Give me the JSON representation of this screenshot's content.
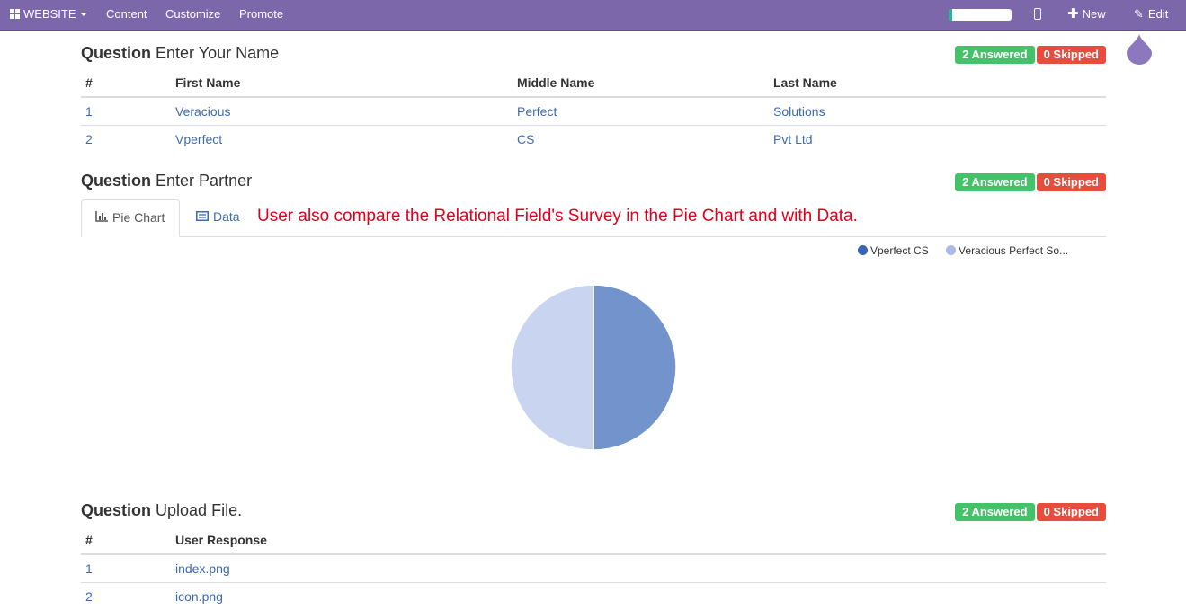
{
  "topbar": {
    "website_label": "WEBSITE",
    "menu": [
      "Content",
      "Customize",
      "Promote"
    ],
    "progress": 0.06,
    "new_label": "New",
    "edit_label": "Edit",
    "color": "#7c67ab"
  },
  "q1": {
    "prefix": "Question",
    "title": "Enter Your Name",
    "answered": "2 Answered",
    "skipped": "0 Skipped",
    "columns": [
      "#",
      "First Name",
      "Middle Name",
      "Last Name"
    ],
    "rows": [
      [
        "1",
        "Veracious",
        "Perfect",
        "Solutions"
      ],
      [
        "2",
        "Vperfect",
        "CS",
        "Pvt Ltd"
      ]
    ]
  },
  "q2": {
    "prefix": "Question",
    "title": "Enter Partner",
    "answered": "2 Answered",
    "skipped": "0 Skipped",
    "tabs": {
      "pie": "Pie Chart",
      "data": "Data"
    },
    "note": "User also compare the Relational Field's Survey in the Pie Chart and with Data."
  },
  "chart_data": {
    "type": "pie",
    "labels": [
      "Vperfect CS",
      "Veracious Perfect So..."
    ],
    "values": [
      1,
      1
    ],
    "colors": [
      "#7393cc",
      "#c9d4f0"
    ],
    "legend_colors": [
      "#3a62b5",
      "#a9b9e8"
    ],
    "legend": "top-right"
  },
  "q3": {
    "prefix": "Question",
    "title": "Upload File.",
    "answered": "2 Answered",
    "skipped": "0 Skipped",
    "columns": [
      "#",
      "User Response"
    ],
    "rows": [
      [
        "1",
        "index.png"
      ],
      [
        "2",
        "icon.png"
      ]
    ]
  }
}
